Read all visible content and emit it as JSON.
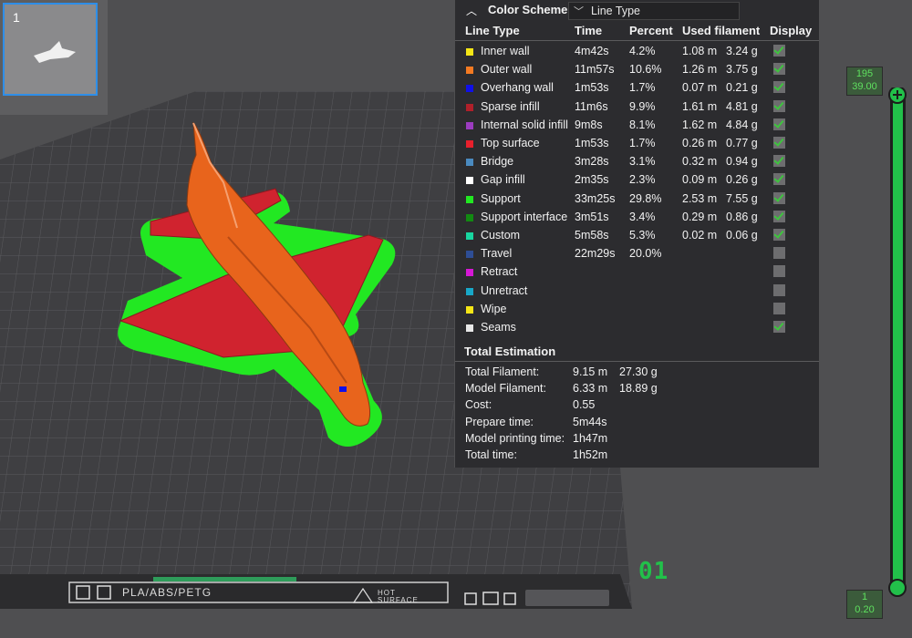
{
  "thumbnail": {
    "index": "1"
  },
  "color_scheme": {
    "title": "Color Scheme",
    "selected": "Line Type",
    "headers": {
      "line_type": "Line Type",
      "time": "Time",
      "percent": "Percent",
      "used": "Used filament",
      "display": "Display"
    },
    "rows": [
      {
        "name": "Inner wall",
        "color": "#f5e616",
        "time": "4m42s",
        "percent": "4.2%",
        "m": "1.08 m",
        "g": "3.24 g",
        "display": true
      },
      {
        "name": "Outer wall",
        "color": "#f47a22",
        "time": "11m57s",
        "percent": "10.6%",
        "m": "1.26 m",
        "g": "3.75 g",
        "display": true
      },
      {
        "name": "Overhang wall",
        "color": "#1010e8",
        "time": "1m53s",
        "percent": "1.7%",
        "m": "0.07 m",
        "g": "0.21 g",
        "display": true
      },
      {
        "name": "Sparse infill",
        "color": "#b0202a",
        "time": "11m6s",
        "percent": "9.9%",
        "m": "1.61 m",
        "g": "4.81 g",
        "display": true
      },
      {
        "name": "Internal solid infill",
        "color": "#9c3cc0",
        "time": "9m8s",
        "percent": "8.1%",
        "m": "1.62 m",
        "g": "4.84 g",
        "display": true
      },
      {
        "name": "Top surface",
        "color": "#e8202c",
        "time": "1m53s",
        "percent": "1.7%",
        "m": "0.26 m",
        "g": "0.77 g",
        "display": true
      },
      {
        "name": "Bridge",
        "color": "#4a8ac0",
        "time": "3m28s",
        "percent": "3.1%",
        "m": "0.32 m",
        "g": "0.94 g",
        "display": true
      },
      {
        "name": "Gap infill",
        "color": "#ffffff",
        "time": "2m35s",
        "percent": "2.3%",
        "m": "0.09 m",
        "g": "0.26 g",
        "display": true
      },
      {
        "name": "Support",
        "color": "#22e822",
        "time": "33m25s",
        "percent": "29.8%",
        "m": "2.53 m",
        "g": "7.55 g",
        "display": true
      },
      {
        "name": "Support interface",
        "color": "#128a12",
        "time": "3m51s",
        "percent": "3.4%",
        "m": "0.29 m",
        "g": "0.86 g",
        "display": true
      },
      {
        "name": "Custom",
        "color": "#18d6a0",
        "time": "5m58s",
        "percent": "5.3%",
        "m": "0.02 m",
        "g": "0.06 g",
        "display": true
      },
      {
        "name": "Travel",
        "color": "#2e4e96",
        "time": "22m29s",
        "percent": "20.0%",
        "m": "",
        "g": "",
        "display": false
      },
      {
        "name": "Retract",
        "color": "#d618d6",
        "time": "",
        "percent": "",
        "m": "",
        "g": "",
        "display": false
      },
      {
        "name": "Unretract",
        "color": "#18a8c8",
        "time": "",
        "percent": "",
        "m": "",
        "g": "",
        "display": false
      },
      {
        "name": "Wipe",
        "color": "#f5e616",
        "time": "",
        "percent": "",
        "m": "",
        "g": "",
        "display": false
      },
      {
        "name": "Seams",
        "color": "#e8e8e8",
        "time": "",
        "percent": "",
        "m": "",
        "g": "",
        "display": true
      }
    ]
  },
  "total_estimation": {
    "title": "Total Estimation",
    "rows": [
      {
        "label": "Total Filament:",
        "value": "9.15 m",
        "value2": "27.30 g"
      },
      {
        "label": "Model Filament:",
        "value": "6.33 m",
        "value2": "18.89 g"
      },
      {
        "label": "Cost:",
        "value": "0.55",
        "value2": ""
      },
      {
        "label": "Prepare time:",
        "value": "5m44s",
        "value2": ""
      },
      {
        "label": "Model printing time:",
        "value": "1h47m",
        "value2": ""
      },
      {
        "label": "Total time:",
        "value": "1h52m",
        "value2": ""
      }
    ]
  },
  "layer_slider": {
    "top_layer": "195",
    "top_height": "39.00",
    "bottom_layer": "1",
    "bottom_height": "0.20"
  },
  "plate": {
    "label": "01",
    "bed_text": "PLA/ABS/PETG",
    "hot_line1": "HOT",
    "hot_line2": "SURFACE"
  },
  "colors": {
    "accent": "#22c04a",
    "support": "#22e822",
    "wall": "#e8641c",
    "surface": "#d0232f"
  }
}
